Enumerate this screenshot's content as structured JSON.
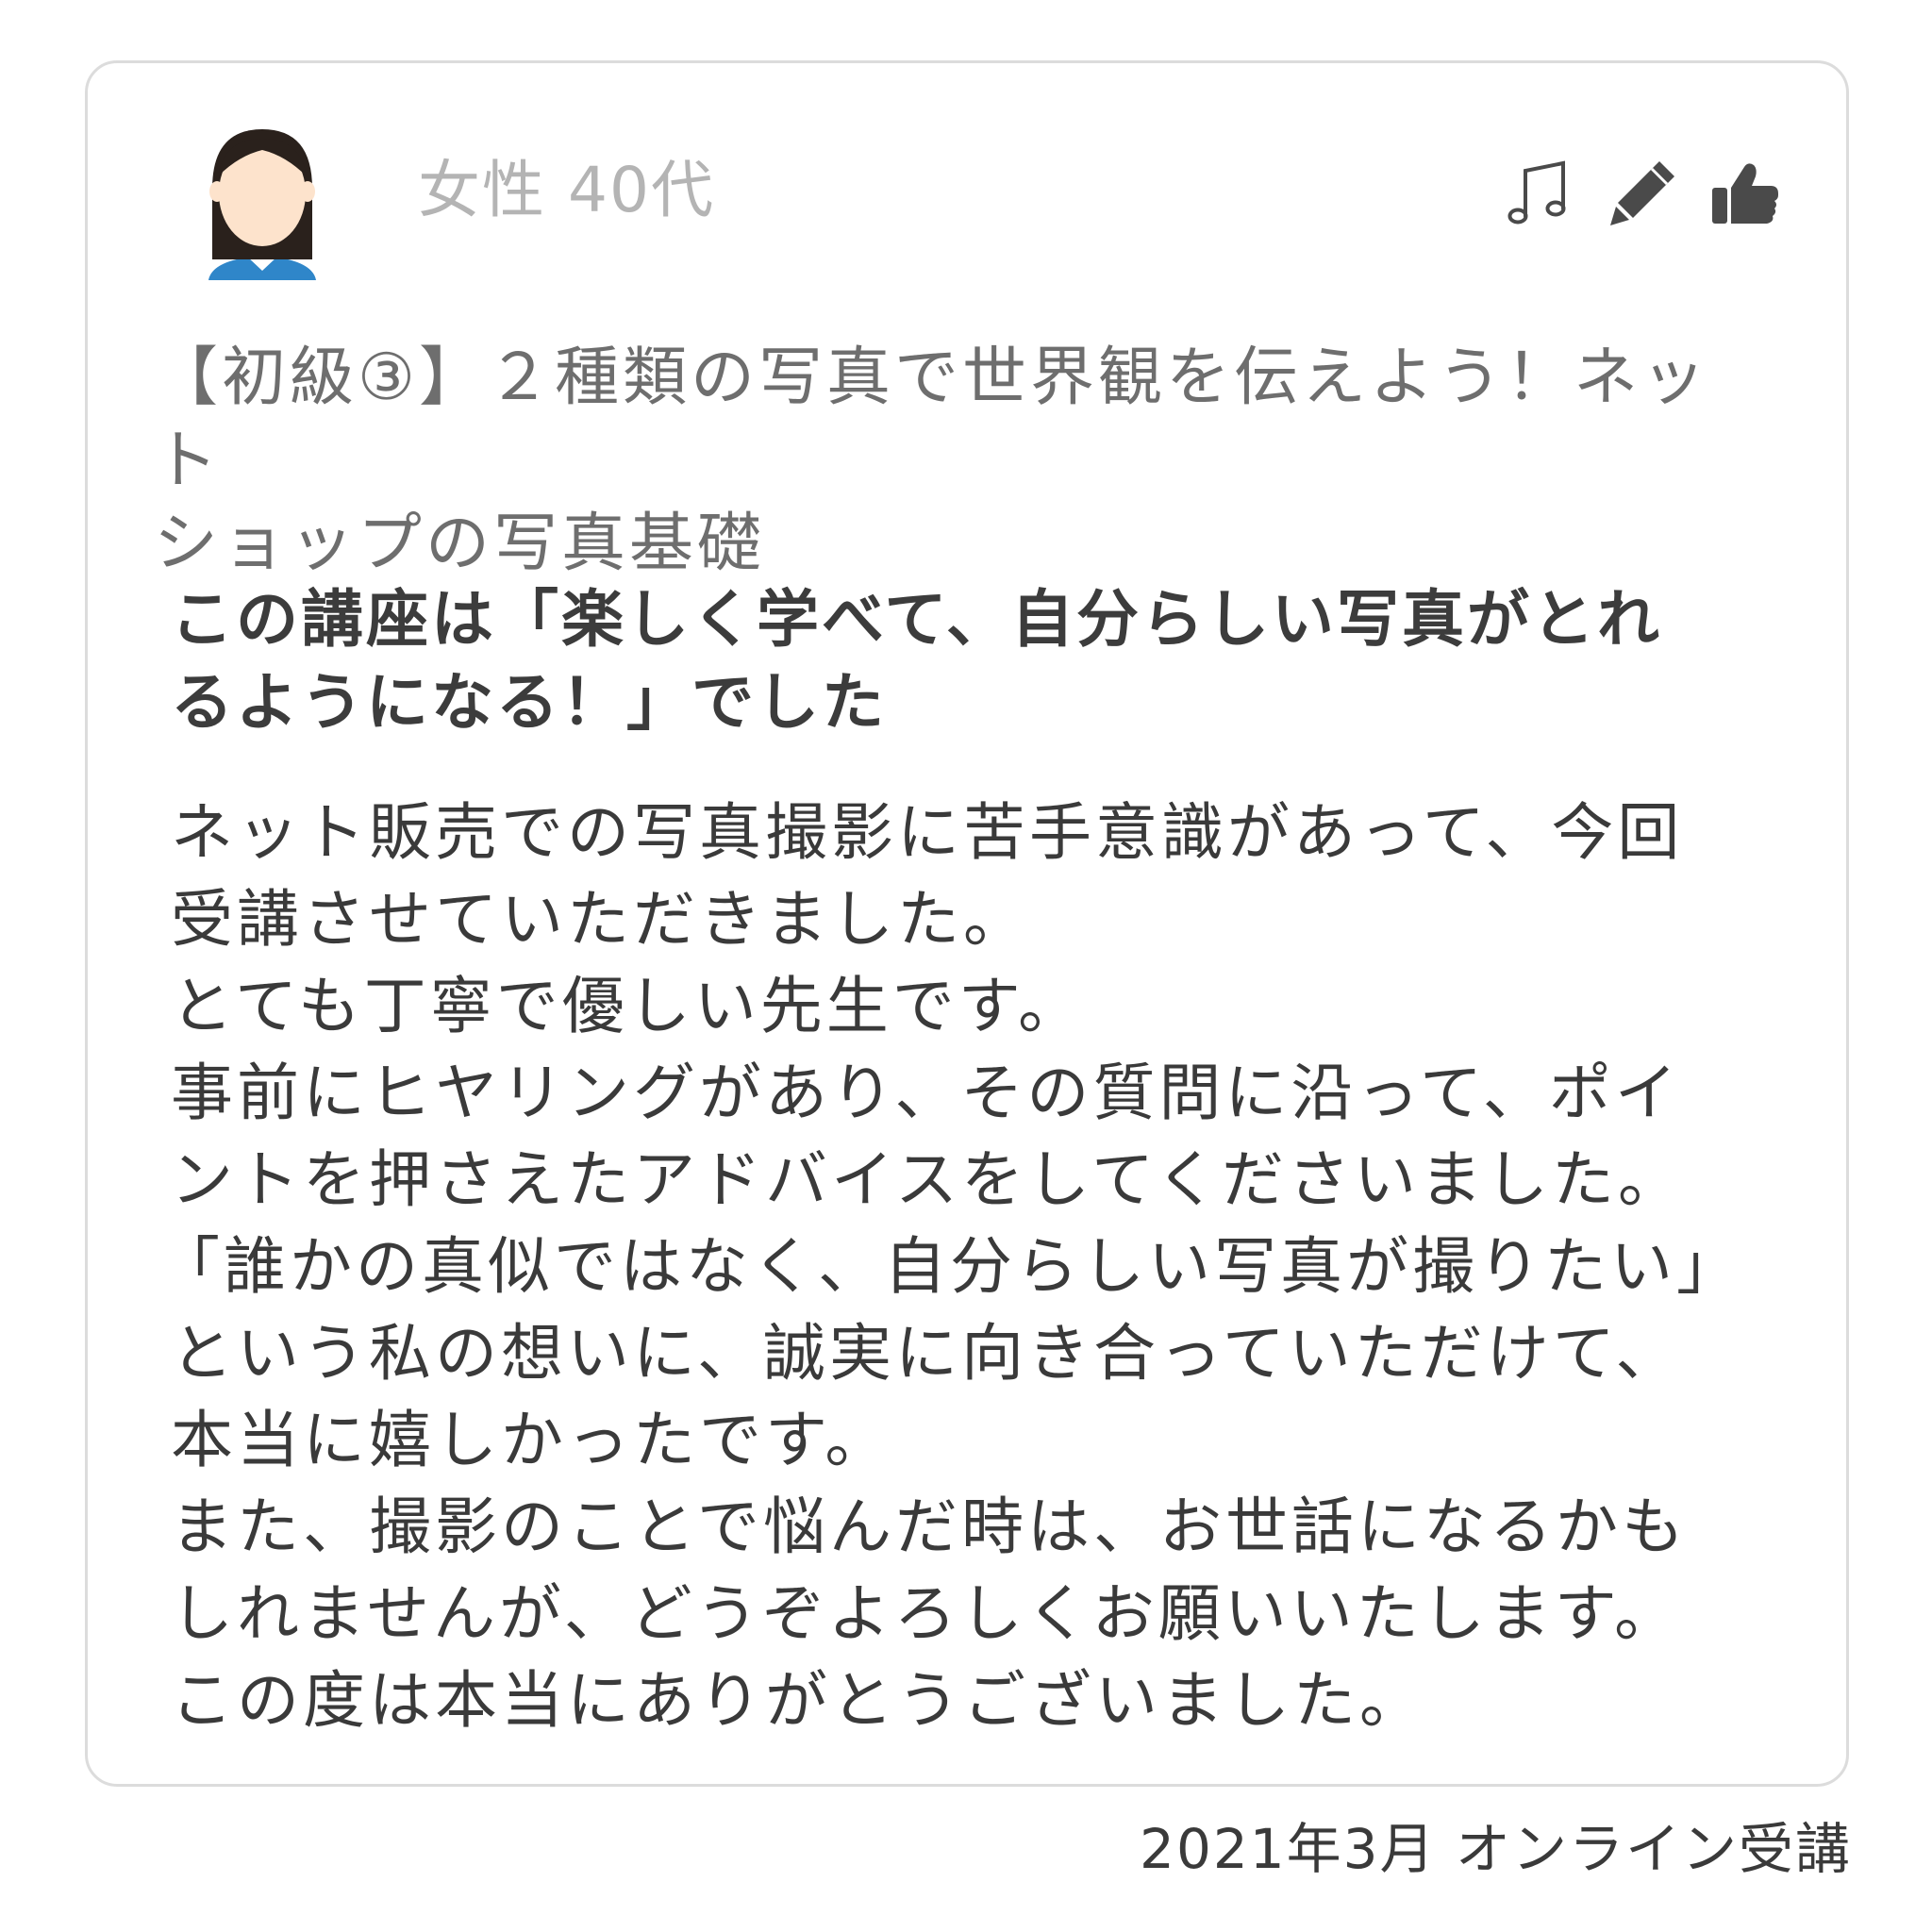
{
  "review": {
    "reviewer": "女性 40代",
    "course_title_lines": [
      "【初級③】２種類の写真で世界観を伝えよう！ネット",
      "ショップの写真基礎"
    ],
    "headline_lines": [
      "この講座は「楽しく学べて、自分らしい写真がとれ",
      "るようになる！」でした"
    ],
    "body_lines": [
      "ネット販売での写真撮影に苦手意識があって、今回",
      "受講させていただきました。",
      "とても丁寧で優しい先生です。",
      "事前にヒヤリングがあり、その質問に沿って、ポイ",
      "ントを押さえたアドバイスをしてくださいました。",
      "「誰かの真似ではなく、自分らしい写真が撮りたい」",
      "という私の想いに、誠実に向き合っていただけて、",
      "本当に嬉しかったです。",
      "また、撮影のことで悩んだ時は、お世話になるかも",
      "しれませんが、どうぞよろしくお願いいたします。",
      "この度は本当にありがとうございました。"
    ],
    "actions": [
      {
        "icon": "music-notes-icon"
      },
      {
        "icon": "pencil-icon"
      },
      {
        "icon": "thumbs-up-icon"
      }
    ]
  },
  "footer": {
    "text": "2021年3月 オンライン受講"
  },
  "colors": {
    "card_border": "#dcdcdc",
    "reviewer_text": "#b4b4b4",
    "title_text": "#6e6e6e",
    "body_text": "#3a3a3a",
    "icon": "#4a4a4a",
    "avatar_hair": "#2a211c",
    "avatar_skin": "#fde3cc",
    "avatar_shirt": "#2f86c9"
  }
}
